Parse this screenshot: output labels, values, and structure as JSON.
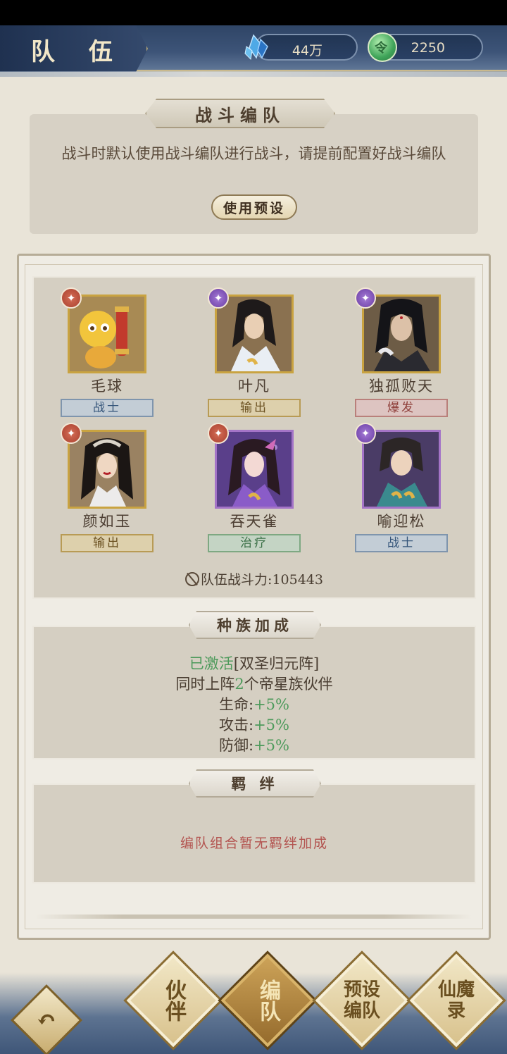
{
  "header": {
    "title": "队 伍",
    "crystal_value": "44万",
    "jade_value": "2250"
  },
  "formation": {
    "title": "战斗编队",
    "description": "战斗时默认使用战斗编队进行战斗，请提前配置好战斗编队",
    "preset_label": "使用预设"
  },
  "heroes": [
    {
      "name": "毛球",
      "role": "战士",
      "element": "fire"
    },
    {
      "name": "叶凡",
      "role": "输出",
      "element": "violet"
    },
    {
      "name": "独孤败天",
      "role": "爆发",
      "element": "violet"
    },
    {
      "name": "颜如玉",
      "role": "输出",
      "element": "fire"
    },
    {
      "name": "吞天雀",
      "role": "治疗",
      "element": "fire"
    },
    {
      "name": "喻迎松",
      "role": "战士",
      "element": "violet"
    }
  ],
  "team_power": {
    "label": "队伍战斗力:",
    "value": "105443"
  },
  "race_bonus": {
    "title": "种族加成",
    "activated": "已激活",
    "formation_name": "[双圣归元阵]",
    "line2_prefix": "同时上阵",
    "line2_count": "2",
    "line2_suffix": "个帝星族伙伴",
    "stats": [
      {
        "label": "生命:",
        "value": "+5%"
      },
      {
        "label": "攻击:",
        "value": "+5%"
      },
      {
        "label": "防御:",
        "value": "+5%"
      }
    ]
  },
  "bond": {
    "title": "羁 绊",
    "empty_text": "编队组合暂无羁绊加成"
  },
  "nav": {
    "partner": "伙伴",
    "formation": "编队",
    "preset": "预设编队",
    "record": "仙魔录"
  },
  "colors": {
    "gold_frame": "#c9a341",
    "purple_frame": "#a474c7",
    "active_green": "#4d9a5b",
    "bond_red": "#b35450"
  }
}
